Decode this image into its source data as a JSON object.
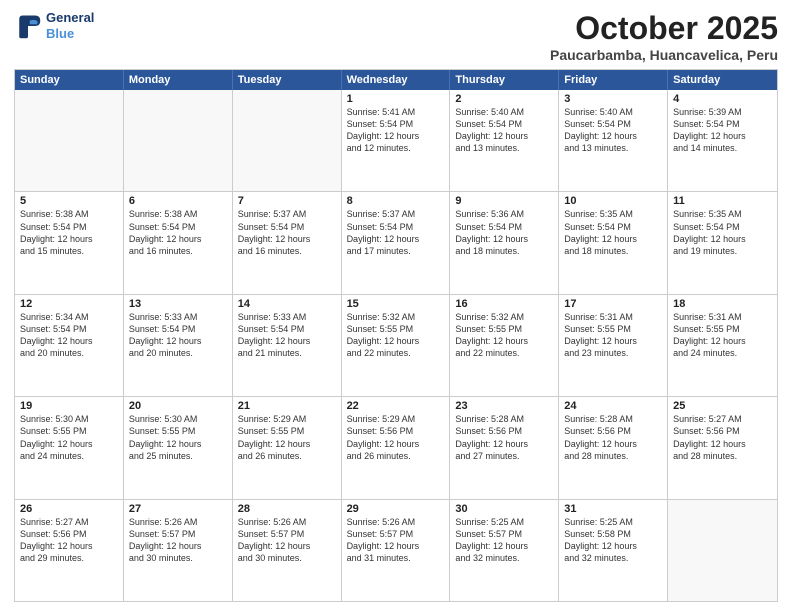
{
  "header": {
    "logo_line1": "General",
    "logo_line2": "Blue",
    "month": "October 2025",
    "location": "Paucarbamba, Huancavelica, Peru"
  },
  "weekdays": [
    "Sunday",
    "Monday",
    "Tuesday",
    "Wednesday",
    "Thursday",
    "Friday",
    "Saturday"
  ],
  "rows": [
    [
      {
        "day": "",
        "info": ""
      },
      {
        "day": "",
        "info": ""
      },
      {
        "day": "",
        "info": ""
      },
      {
        "day": "1",
        "info": "Sunrise: 5:41 AM\nSunset: 5:54 PM\nDaylight: 12 hours\nand 12 minutes."
      },
      {
        "day": "2",
        "info": "Sunrise: 5:40 AM\nSunset: 5:54 PM\nDaylight: 12 hours\nand 13 minutes."
      },
      {
        "day": "3",
        "info": "Sunrise: 5:40 AM\nSunset: 5:54 PM\nDaylight: 12 hours\nand 13 minutes."
      },
      {
        "day": "4",
        "info": "Sunrise: 5:39 AM\nSunset: 5:54 PM\nDaylight: 12 hours\nand 14 minutes."
      }
    ],
    [
      {
        "day": "5",
        "info": "Sunrise: 5:38 AM\nSunset: 5:54 PM\nDaylight: 12 hours\nand 15 minutes."
      },
      {
        "day": "6",
        "info": "Sunrise: 5:38 AM\nSunset: 5:54 PM\nDaylight: 12 hours\nand 16 minutes."
      },
      {
        "day": "7",
        "info": "Sunrise: 5:37 AM\nSunset: 5:54 PM\nDaylight: 12 hours\nand 16 minutes."
      },
      {
        "day": "8",
        "info": "Sunrise: 5:37 AM\nSunset: 5:54 PM\nDaylight: 12 hours\nand 17 minutes."
      },
      {
        "day": "9",
        "info": "Sunrise: 5:36 AM\nSunset: 5:54 PM\nDaylight: 12 hours\nand 18 minutes."
      },
      {
        "day": "10",
        "info": "Sunrise: 5:35 AM\nSunset: 5:54 PM\nDaylight: 12 hours\nand 18 minutes."
      },
      {
        "day": "11",
        "info": "Sunrise: 5:35 AM\nSunset: 5:54 PM\nDaylight: 12 hours\nand 19 minutes."
      }
    ],
    [
      {
        "day": "12",
        "info": "Sunrise: 5:34 AM\nSunset: 5:54 PM\nDaylight: 12 hours\nand 20 minutes."
      },
      {
        "day": "13",
        "info": "Sunrise: 5:33 AM\nSunset: 5:54 PM\nDaylight: 12 hours\nand 20 minutes."
      },
      {
        "day": "14",
        "info": "Sunrise: 5:33 AM\nSunset: 5:54 PM\nDaylight: 12 hours\nand 21 minutes."
      },
      {
        "day": "15",
        "info": "Sunrise: 5:32 AM\nSunset: 5:55 PM\nDaylight: 12 hours\nand 22 minutes."
      },
      {
        "day": "16",
        "info": "Sunrise: 5:32 AM\nSunset: 5:55 PM\nDaylight: 12 hours\nand 22 minutes."
      },
      {
        "day": "17",
        "info": "Sunrise: 5:31 AM\nSunset: 5:55 PM\nDaylight: 12 hours\nand 23 minutes."
      },
      {
        "day": "18",
        "info": "Sunrise: 5:31 AM\nSunset: 5:55 PM\nDaylight: 12 hours\nand 24 minutes."
      }
    ],
    [
      {
        "day": "19",
        "info": "Sunrise: 5:30 AM\nSunset: 5:55 PM\nDaylight: 12 hours\nand 24 minutes."
      },
      {
        "day": "20",
        "info": "Sunrise: 5:30 AM\nSunset: 5:55 PM\nDaylight: 12 hours\nand 25 minutes."
      },
      {
        "day": "21",
        "info": "Sunrise: 5:29 AM\nSunset: 5:55 PM\nDaylight: 12 hours\nand 26 minutes."
      },
      {
        "day": "22",
        "info": "Sunrise: 5:29 AM\nSunset: 5:56 PM\nDaylight: 12 hours\nand 26 minutes."
      },
      {
        "day": "23",
        "info": "Sunrise: 5:28 AM\nSunset: 5:56 PM\nDaylight: 12 hours\nand 27 minutes."
      },
      {
        "day": "24",
        "info": "Sunrise: 5:28 AM\nSunset: 5:56 PM\nDaylight: 12 hours\nand 28 minutes."
      },
      {
        "day": "25",
        "info": "Sunrise: 5:27 AM\nSunset: 5:56 PM\nDaylight: 12 hours\nand 28 minutes."
      }
    ],
    [
      {
        "day": "26",
        "info": "Sunrise: 5:27 AM\nSunset: 5:56 PM\nDaylight: 12 hours\nand 29 minutes."
      },
      {
        "day": "27",
        "info": "Sunrise: 5:26 AM\nSunset: 5:57 PM\nDaylight: 12 hours\nand 30 minutes."
      },
      {
        "day": "28",
        "info": "Sunrise: 5:26 AM\nSunset: 5:57 PM\nDaylight: 12 hours\nand 30 minutes."
      },
      {
        "day": "29",
        "info": "Sunrise: 5:26 AM\nSunset: 5:57 PM\nDaylight: 12 hours\nand 31 minutes."
      },
      {
        "day": "30",
        "info": "Sunrise: 5:25 AM\nSunset: 5:57 PM\nDaylight: 12 hours\nand 32 minutes."
      },
      {
        "day": "31",
        "info": "Sunrise: 5:25 AM\nSunset: 5:58 PM\nDaylight: 12 hours\nand 32 minutes."
      },
      {
        "day": "",
        "info": ""
      }
    ]
  ]
}
